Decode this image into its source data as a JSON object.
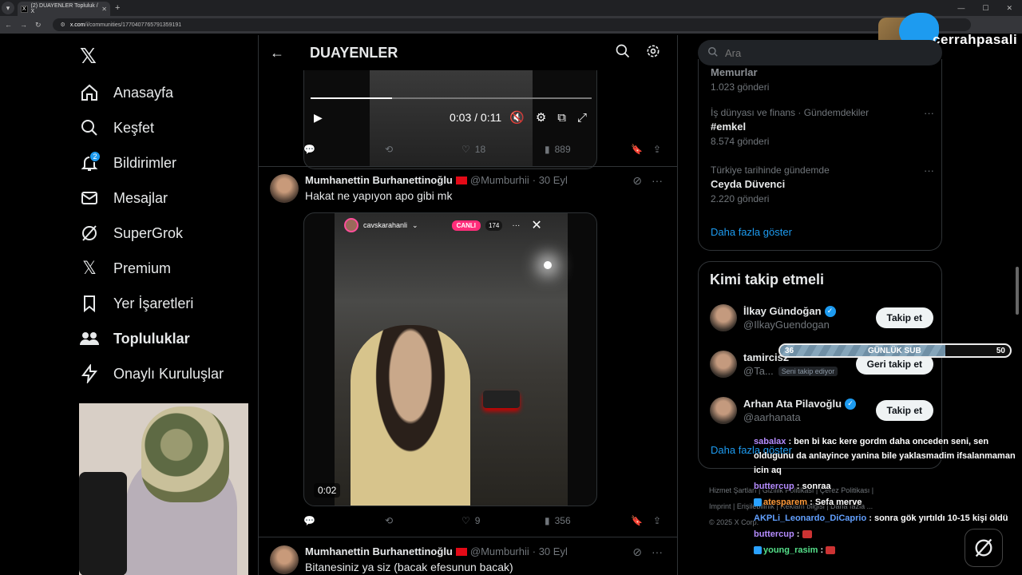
{
  "browser": {
    "tab_title": "(2) DUAYENLER Topluluk / X",
    "url_host": "x.com",
    "url_path": "/i/communities/1770407765791359191"
  },
  "nav": {
    "items": [
      {
        "label": "Anasayfa",
        "icon": "home-icon"
      },
      {
        "label": "Keşfet",
        "icon": "search-icon"
      },
      {
        "label": "Bildirimler",
        "icon": "bell-icon",
        "badge": "2"
      },
      {
        "label": "Mesajlar",
        "icon": "mail-icon"
      },
      {
        "label": "SuperGrok",
        "icon": "grok-icon"
      },
      {
        "label": "Premium",
        "icon": "x-icon"
      },
      {
        "label": "Yer İşaretleri",
        "icon": "bookmark-icon"
      },
      {
        "label": "Topluluklar",
        "icon": "people-icon"
      },
      {
        "label": "Onaylı Kuruluşlar",
        "icon": "lightning-icon"
      }
    ]
  },
  "header": {
    "title": "DUAYENLER"
  },
  "video1": {
    "time": "0:03 / 0:11",
    "progress": 0.29
  },
  "tweet1_actions": {
    "likes": "18",
    "views": "889"
  },
  "tweet2": {
    "name": "Mumhanettin Burhanettinoğlu",
    "handle": "@Mumburhii",
    "date": "· 30 Eyl",
    "text": "Hakat ne yapıyon apo gibi mk",
    "video": {
      "channel": "cavskarahanli",
      "live": "CANLI",
      "viewers": "174",
      "time": "0:02"
    },
    "likes": "9",
    "views": "356"
  },
  "tweet3": {
    "name": "Mumhanettin Burhanettinoğlu",
    "handle": "@Mumburhii",
    "date": "· 30 Eyl",
    "text": "Bitanesiniz ya siz (bacak efesunun bacak)"
  },
  "search": {
    "placeholder": "Ara"
  },
  "trends": [
    {
      "category": "",
      "name": "Memurlar",
      "count": "1.023 gönderi"
    },
    {
      "category": "İş dünyası ve finans · Gündemdekiler",
      "name": "#emkel",
      "count": "8.574 gönderi"
    },
    {
      "category": "Türkiye tarihinde gündemde",
      "name": "Ceyda Düvenci",
      "count": "2.220 gönderi"
    }
  ],
  "trends_show_more": "Daha fazla göster",
  "who_to_follow": {
    "title": "Kimi takip etmeli",
    "users": [
      {
        "name": "İlkay Gündoğan",
        "handle": "@IlkayGuendogan",
        "button": "Takip et",
        "verified": true
      },
      {
        "name": "tamircis2",
        "handle": "@Ta...",
        "follows_you": "Seni takip ediyor",
        "button": "Geri takip et",
        "verified": false
      },
      {
        "name": "Arhan Ata Pilavoğlu",
        "handle": "@aarhanata",
        "button": "Takip et",
        "verified": true
      }
    ],
    "show_more": "Daha fazla göster"
  },
  "footer": {
    "line1": "Hizmet Şartları | Gizlilik Politikası | Çerez Politikası |",
    "line2": "Imprint | Erişilebilirlik | Reklam bilgisi | Daha fazla ...",
    "line3": "© 2025 X Corp."
  },
  "overlay": {
    "brand": "cerrahpasali",
    "subgoal": {
      "label": "GÜNLÜK SUB",
      "current": "36",
      "target": "50",
      "fraction": 0.72
    },
    "chat": [
      {
        "user": "sabalax",
        "text": ": ben bi kac kere gordm daha onceden seni, sen oldugunu da anlayince yanina bile yaklasmadim ifsalanmaman icin aq",
        "color": "purple"
      },
      {
        "user": "buttercup",
        "text": ": sonraa",
        "color": "purple"
      },
      {
        "user": "atesparem",
        "text": ": Sefa merve",
        "color": "orange"
      },
      {
        "user": "AKPLi_Leonardo_DiCaprio",
        "text": ": sonra gök yırtıldı 10-15 kişi öldü",
        "color": "blue"
      },
      {
        "user": "buttercup",
        "text": ":",
        "color": "purple"
      },
      {
        "user": "young_rasim",
        "text": ":",
        "color": "green"
      }
    ]
  }
}
